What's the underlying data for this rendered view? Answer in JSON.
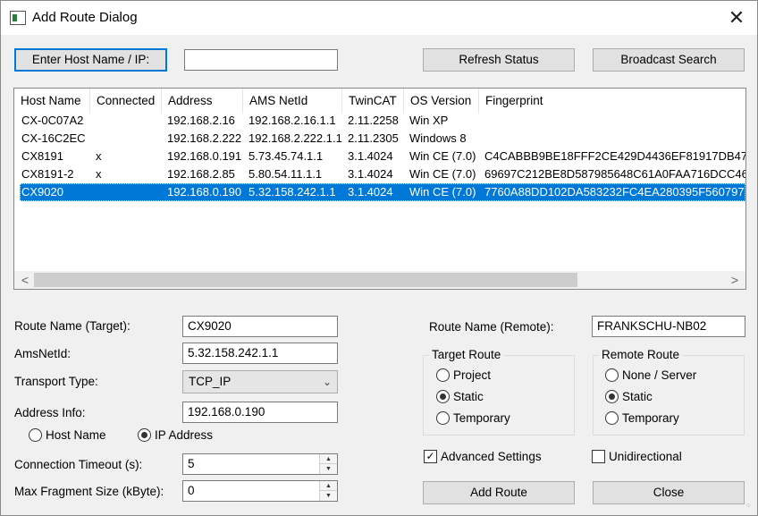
{
  "window": {
    "title": "Add Route Dialog",
    "close_glyph": "✕"
  },
  "toolbar": {
    "enter_host_label": "Enter Host Name / IP:",
    "host_input_value": "",
    "refresh_label": "Refresh Status",
    "broadcast_label": "Broadcast Search"
  },
  "list": {
    "columns": [
      "Host Name",
      "Connected",
      "Address",
      "AMS NetId",
      "TwinCAT",
      "OS Version",
      "Fingerprint"
    ],
    "rows": [
      [
        "CX-0C07A2",
        "",
        "192.168.2.16",
        "192.168.2.16.1.1",
        "2.11.2258",
        "Win XP",
        ""
      ],
      [
        "CX-16C2EC",
        "",
        "192.168.2.222",
        "192.168.2.222.1.1",
        "2.11.2305",
        "Windows 8",
        ""
      ],
      [
        "CX8191",
        "x",
        "192.168.0.191",
        "5.73.45.74.1.1",
        "3.1.4024",
        "Win CE (7.0)",
        "C4CABBB9BE18FFF2CE429D4436EF81917DB47"
      ],
      [
        "CX8191-2",
        "x",
        "192.168.2.85",
        "5.80.54.11.1.1",
        "3.1.4024",
        "Win CE (7.0)",
        "69697C212BE8D587985648C61A0FAA716DCC46"
      ],
      [
        "CX9020",
        "",
        "192.168.0.190",
        "5.32.158.242.1.1",
        "3.1.4024",
        "Win CE (7.0)",
        "7760A88DD102DA583232FC4EA280395F560797"
      ]
    ],
    "selected_row": 4,
    "scroll_left": "<",
    "scroll_right": ">"
  },
  "form": {
    "route_name_label": "Route Name (Target):",
    "route_name_value": "CX9020",
    "amsnetid_label": "AmsNetId:",
    "amsnetid_value": "5.32.158.242.1.1",
    "transport_label": "Transport Type:",
    "transport_value": "TCP_IP",
    "address_label": "Address Info:",
    "address_value": "192.168.0.190",
    "host_name_radio": "Host Name",
    "ip_address_radio": "IP Address",
    "address_mode": "IP Address",
    "timeout_label": "Connection Timeout (s):",
    "timeout_value": "5",
    "fragment_label": "Max Fragment Size (kByte):",
    "fragment_value": "0"
  },
  "remote": {
    "route_name_remote_label": "Route Name (Remote):",
    "route_name_remote_value": "FRANKSCHU-NB02"
  },
  "target_route": {
    "title": "Target Route",
    "options": [
      "Project",
      "Static",
      "Temporary"
    ],
    "selected": "Static"
  },
  "remote_route": {
    "title": "Remote Route",
    "options": [
      "None / Server",
      "Static",
      "Temporary"
    ],
    "selected": "Static"
  },
  "options": {
    "advanced_label": "Advanced Settings",
    "advanced_checked": true,
    "unidirectional_label": "Unidirectional",
    "unidirectional_checked": false,
    "check_glyph": "✓"
  },
  "actions": {
    "add_route_label": "Add Route",
    "close_label": "Close"
  },
  "icons": {
    "window_icon": "app-window-icon",
    "close": "close-icon",
    "dropdown": "chevron-down-icon",
    "spin_up": "spin-up-icon",
    "spin_down": "spin-down-icon"
  },
  "colors": {
    "selection": "#0078d7",
    "dialog_bg": "#f0f0f0",
    "button_bg": "#e1e1e1"
  }
}
